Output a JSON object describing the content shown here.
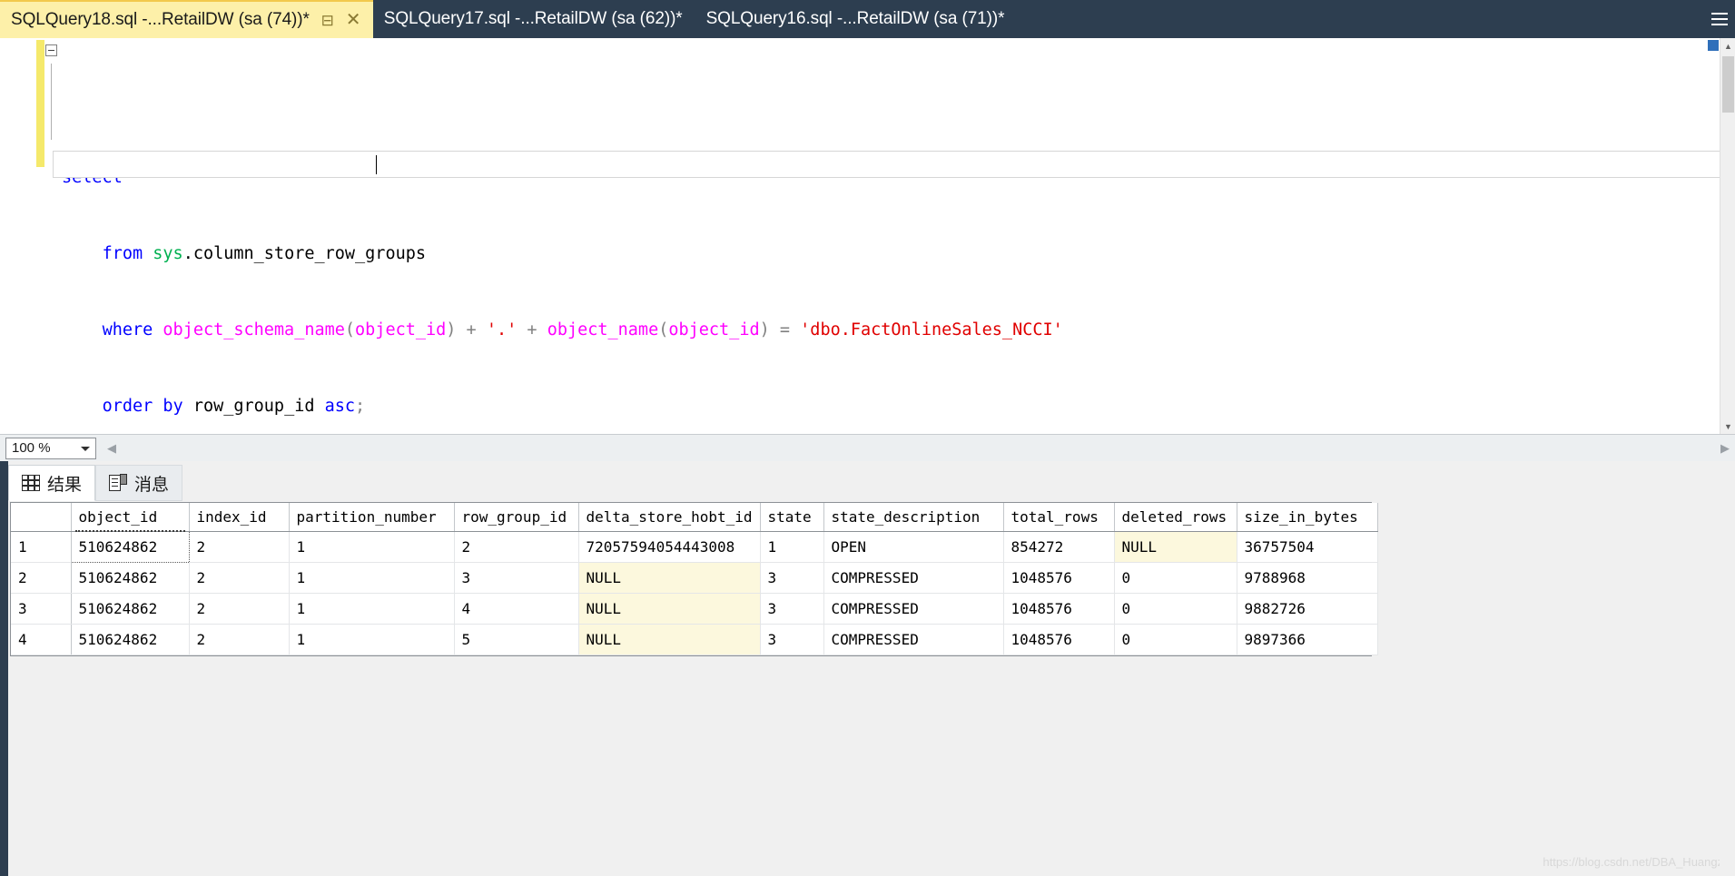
{
  "window": {
    "tabs": [
      {
        "title": "SQLQuery18.sql -...RetailDW (sa (74))*",
        "active": true,
        "pin_icon": "pin-icon",
        "close_icon": "close-icon"
      },
      {
        "title": "SQLQuery17.sql -...RetailDW (sa (62))*",
        "active": false
      },
      {
        "title": "SQLQuery16.sql -...RetailDW (sa (71))*",
        "active": false
      }
    ],
    "overflow_icon": "tab-overflow-menu-icon"
  },
  "editor": {
    "lines": [
      [
        {
          "t": "select",
          "c": "kw"
        },
        {
          "t": " ",
          "c": "plain"
        },
        {
          "t": "*",
          "c": "op"
        }
      ],
      [
        {
          "t": "    ",
          "c": "plain"
        },
        {
          "t": "from",
          "c": "kw"
        },
        {
          "t": " ",
          "c": "plain"
        },
        {
          "t": "sys",
          "c": "sys"
        },
        {
          "t": ".column_store_row_groups",
          "c": "plain"
        }
      ],
      [
        {
          "t": "    ",
          "c": "plain"
        },
        {
          "t": "where",
          "c": "kw"
        },
        {
          "t": " ",
          "c": "plain"
        },
        {
          "t": "object_schema_name",
          "c": "fn"
        },
        {
          "t": "(",
          "c": "op"
        },
        {
          "t": "object_id",
          "c": "fn"
        },
        {
          "t": ")",
          "c": "op"
        },
        {
          "t": " + ",
          "c": "op"
        },
        {
          "t": "'.'",
          "c": "str"
        },
        {
          "t": " + ",
          "c": "op"
        },
        {
          "t": "object_name",
          "c": "fn"
        },
        {
          "t": "(",
          "c": "op"
        },
        {
          "t": "object_id",
          "c": "fn"
        },
        {
          "t": ")",
          "c": "op"
        },
        {
          "t": " = ",
          "c": "op"
        },
        {
          "t": "'dbo.FactOnlineSales_NCCI'",
          "c": "str"
        }
      ],
      [
        {
          "t": "    ",
          "c": "plain"
        },
        {
          "t": "order",
          "c": "kw"
        },
        {
          "t": " ",
          "c": "plain"
        },
        {
          "t": "by",
          "c": "kw"
        },
        {
          "t": " ",
          "c": "plain"
        },
        {
          "t": "row_group_id",
          "c": "plain"
        },
        {
          "t": " ",
          "c": "plain"
        },
        {
          "t": "asc",
          "c": "kw"
        },
        {
          "t": ";",
          "c": "op"
        }
      ]
    ],
    "collapse_icon": "collapse-minus-icon",
    "scroll_up_icon": "▲",
    "scroll_down_icon": "▼"
  },
  "zoombar": {
    "zoom_value": "100 %",
    "dropdown_icon": "chevron-down-icon",
    "scroll_left_icon": "◀",
    "scroll_right_icon": "▶"
  },
  "result_tabs": [
    {
      "label": "结果",
      "icon": "results-grid-icon",
      "active": true
    },
    {
      "label": "消息",
      "icon": "messages-icon",
      "active": false
    }
  ],
  "grid": {
    "rownum_header": "",
    "columns": [
      "object_id",
      "index_id",
      "partition_number",
      "row_group_id",
      "delta_store_hobt_id",
      "state",
      "state_description",
      "total_rows",
      "deleted_rows",
      "size_in_bytes"
    ],
    "rows": [
      {
        "n": "1",
        "cells": [
          "510624862",
          "2",
          "1",
          "2",
          "72057594054443008",
          "1",
          "OPEN",
          "854272",
          "NULL",
          "36757504"
        ],
        "nulls": [
          false,
          false,
          false,
          false,
          false,
          false,
          false,
          false,
          true,
          false
        ],
        "selected_index": 0
      },
      {
        "n": "2",
        "cells": [
          "510624862",
          "2",
          "1",
          "3",
          "NULL",
          "3",
          "COMPRESSED",
          "1048576",
          "0",
          "9788968"
        ],
        "nulls": [
          false,
          false,
          false,
          false,
          true,
          false,
          false,
          false,
          false,
          false
        ],
        "selected_index": -1
      },
      {
        "n": "3",
        "cells": [
          "510624862",
          "2",
          "1",
          "4",
          "NULL",
          "3",
          "COMPRESSED",
          "1048576",
          "0",
          "9882726"
        ],
        "nulls": [
          false,
          false,
          false,
          false,
          true,
          false,
          false,
          false,
          false,
          false
        ],
        "selected_index": -1
      },
      {
        "n": "4",
        "cells": [
          "510624862",
          "2",
          "1",
          "5",
          "NULL",
          "3",
          "COMPRESSED",
          "1048576",
          "0",
          "9897366"
        ],
        "nulls": [
          false,
          false,
          false,
          false,
          true,
          false,
          false,
          false,
          false,
          false
        ],
        "selected_index": -1
      }
    ]
  },
  "watermark": "https://blog.csdn.net/DBA_Huangzj",
  "colors": {
    "tab_active_bg": "#fdf0a9",
    "tabstrip_bg": "#2d3e50",
    "keyword": "#0000ff",
    "schema": "#00b050",
    "function": "#ff00ff",
    "string": "#e00000",
    "operator": "#808080",
    "null_cell_bg": "#fcf8dd",
    "change_bar": "#f5e96b"
  }
}
